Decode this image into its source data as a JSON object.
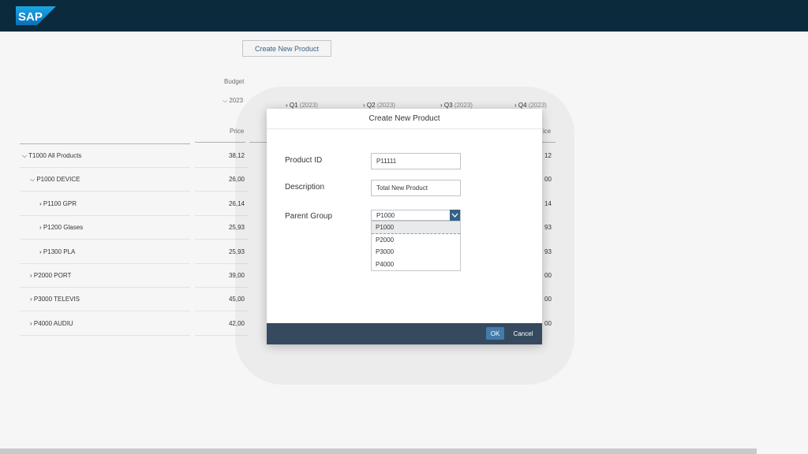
{
  "shell": {
    "logo_text": "SAP"
  },
  "toolbar": {
    "create_label": "Create New Product"
  },
  "table": {
    "header_budget": "Budget",
    "header_year": "2023",
    "header_price": "Price",
    "header_price_partial": "ice",
    "quarters": [
      {
        "label": "Q1",
        "year": "(2023)"
      },
      {
        "label": "Q2",
        "year": "(2023)"
      },
      {
        "label": "Q3",
        "year": "(2023)"
      },
      {
        "label": "Q4",
        "year": "(2023)"
      }
    ],
    "rows": [
      {
        "label": "T1000 All Products",
        "price": "38,12",
        "q4": "12"
      },
      {
        "label": "P1000 DEVICE",
        "price": "26,00",
        "q4": "00"
      },
      {
        "label": "P1100 GPR",
        "price": "26,14",
        "q4": "14"
      },
      {
        "label": "P1200 Glases",
        "price": "25,93",
        "q4": "93"
      },
      {
        "label": "P1300 PLA",
        "price": "25,93",
        "q4": "93"
      },
      {
        "label": "P2000 PORT",
        "price": "39,00",
        "q4": "00"
      },
      {
        "label": "P3000 TELEVIS",
        "price": "45,00",
        "q4": "00"
      },
      {
        "label": "P4000 AUDIU",
        "price": "42,00",
        "q4": "00"
      }
    ]
  },
  "dialog": {
    "title": "Create New Product",
    "product_id_label": "Product ID",
    "product_id_value": "P11111",
    "description_label": "Description",
    "description_value": "Total New Product",
    "parent_group_label": "Parent Group",
    "parent_group_value": "P1000",
    "options": [
      "P1000",
      "P2000",
      "P3000",
      "P4000"
    ],
    "ok_label": "OK",
    "cancel_label": "Cancel"
  },
  "colors": {
    "shell": "#0b2a3c",
    "footer": "#354a5f",
    "ok": "#427cac",
    "select_arrow": "#346187"
  }
}
